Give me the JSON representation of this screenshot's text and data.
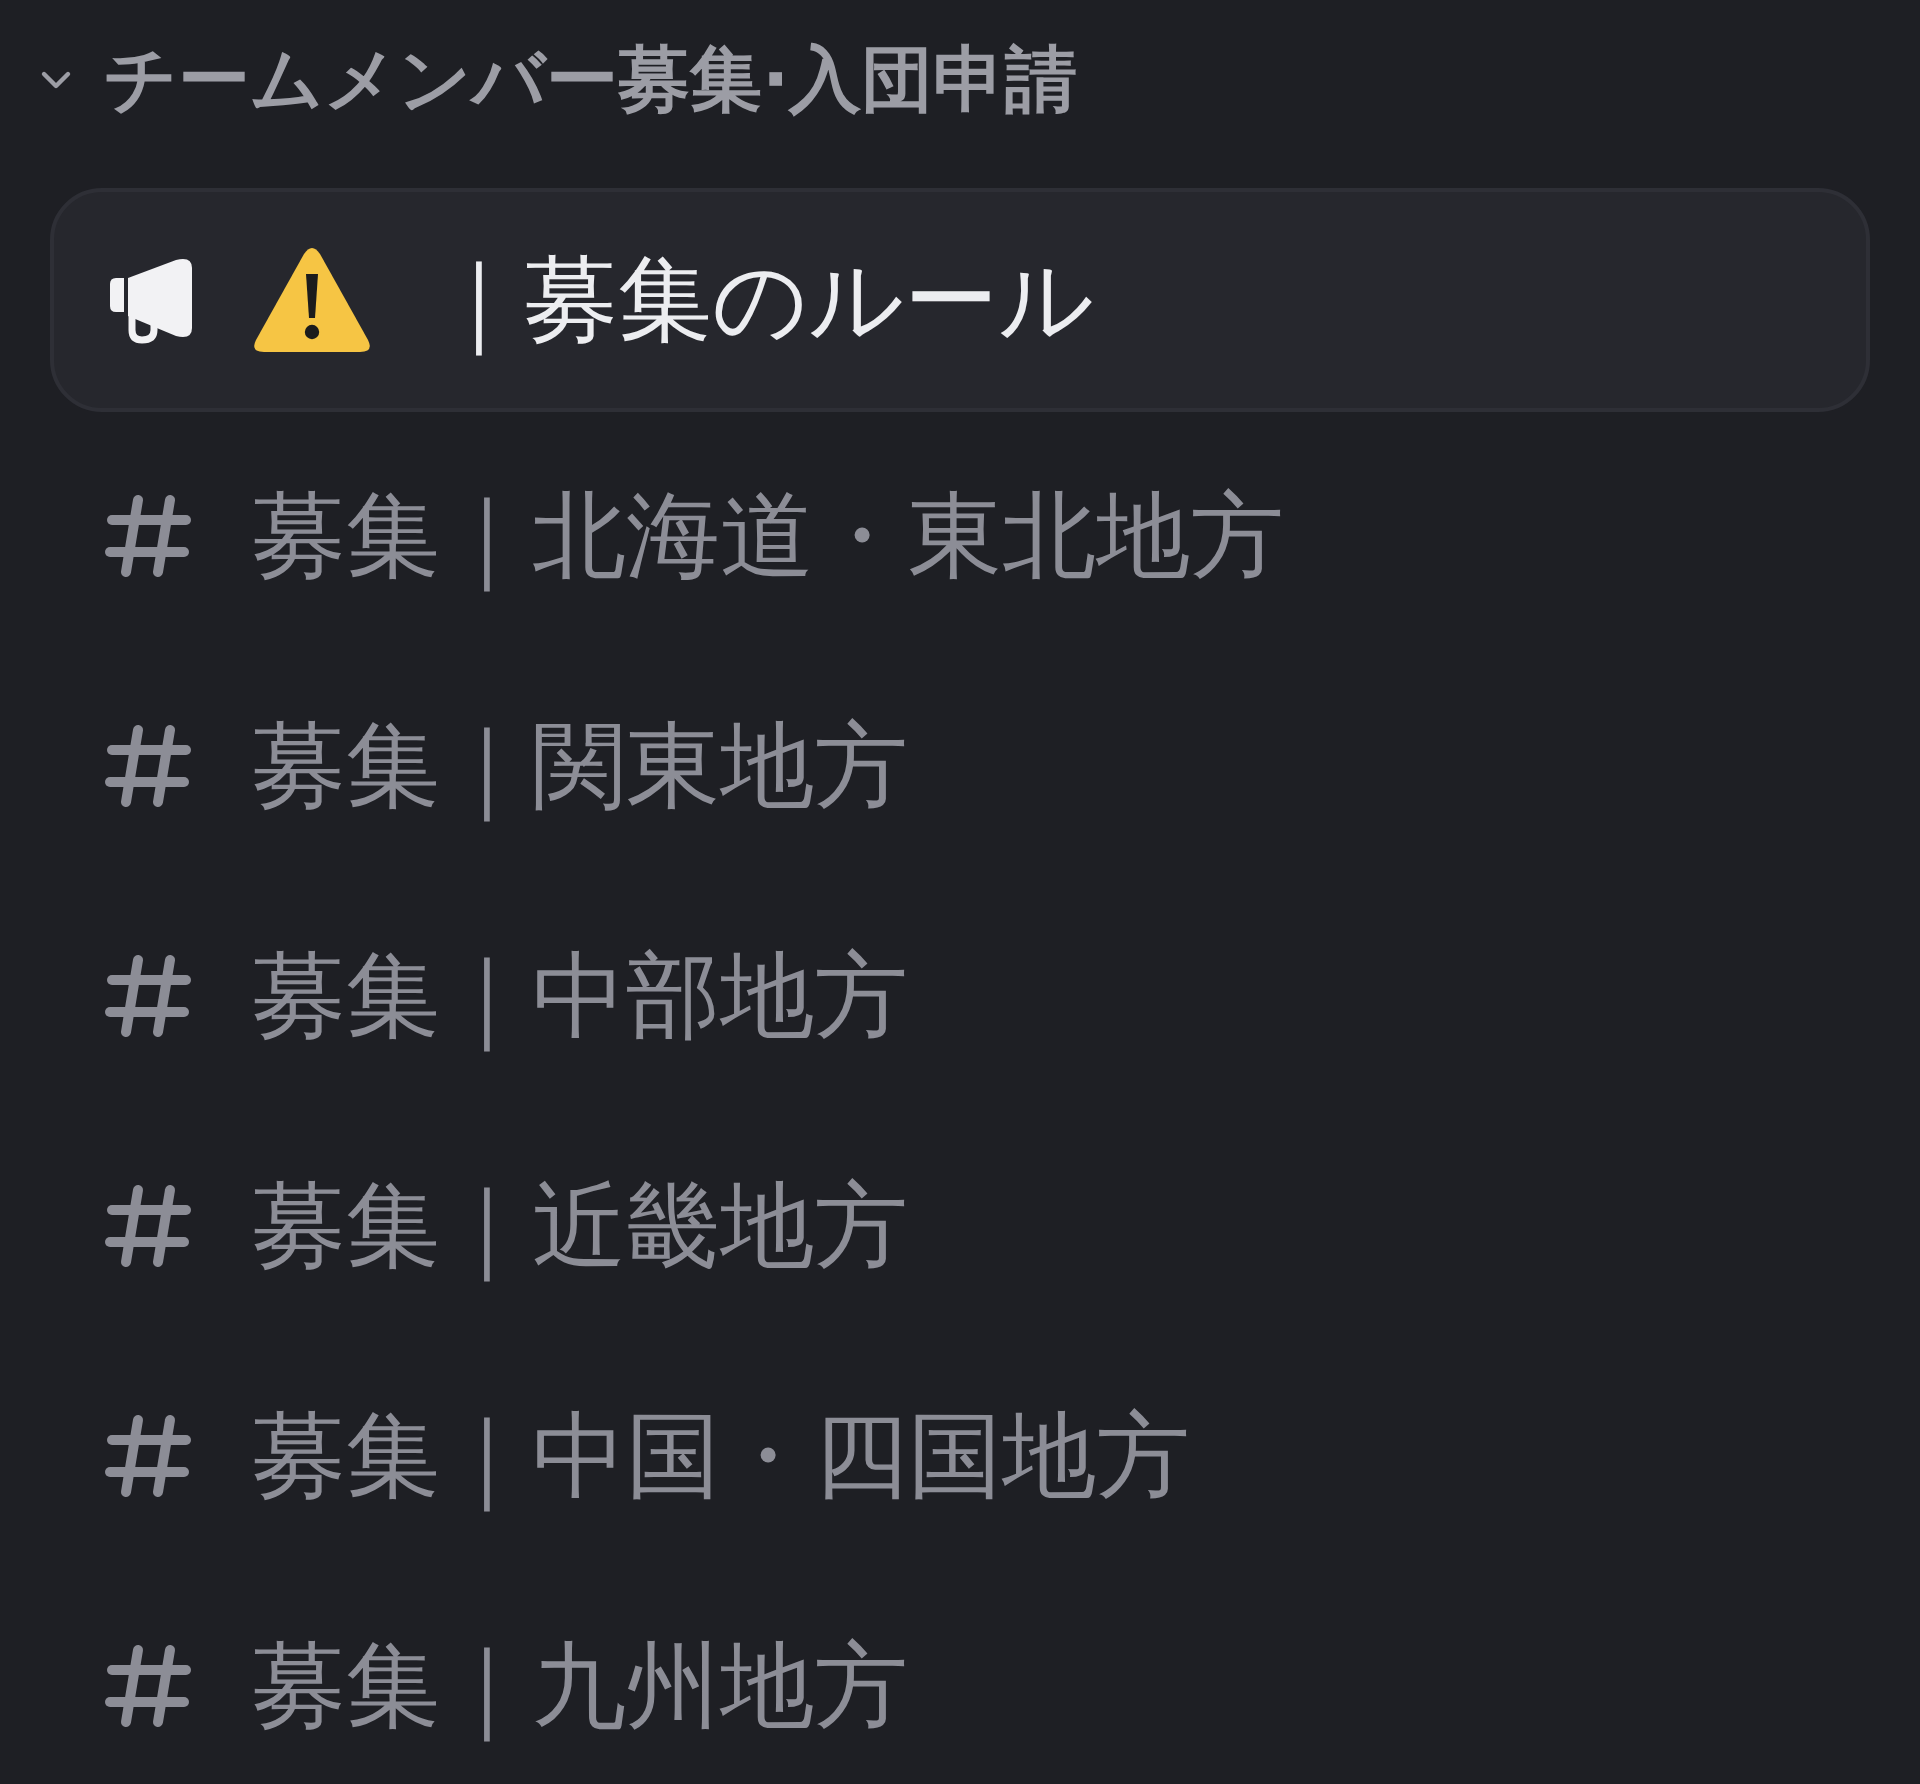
{
  "category": {
    "title": "チームメンバー募集·入団申請",
    "expanded": true
  },
  "channels": [
    {
      "kind": "announcement",
      "badge": {
        "kind": "warning"
      },
      "name": "｜募集のルール",
      "selected": true
    },
    {
      "kind": "text",
      "name": "募集｜北海道・東北地方",
      "selected": false
    },
    {
      "kind": "text",
      "name": "募集｜関東地方",
      "selected": false
    },
    {
      "kind": "text",
      "name": "募集｜中部地方",
      "selected": false
    },
    {
      "kind": "text",
      "name": "募集｜近畿地方",
      "selected": false
    },
    {
      "kind": "text",
      "name": "募集｜中国・四国地方",
      "selected": false
    },
    {
      "kind": "text",
      "name": "募集｜九州地方",
      "selected": false
    }
  ]
}
